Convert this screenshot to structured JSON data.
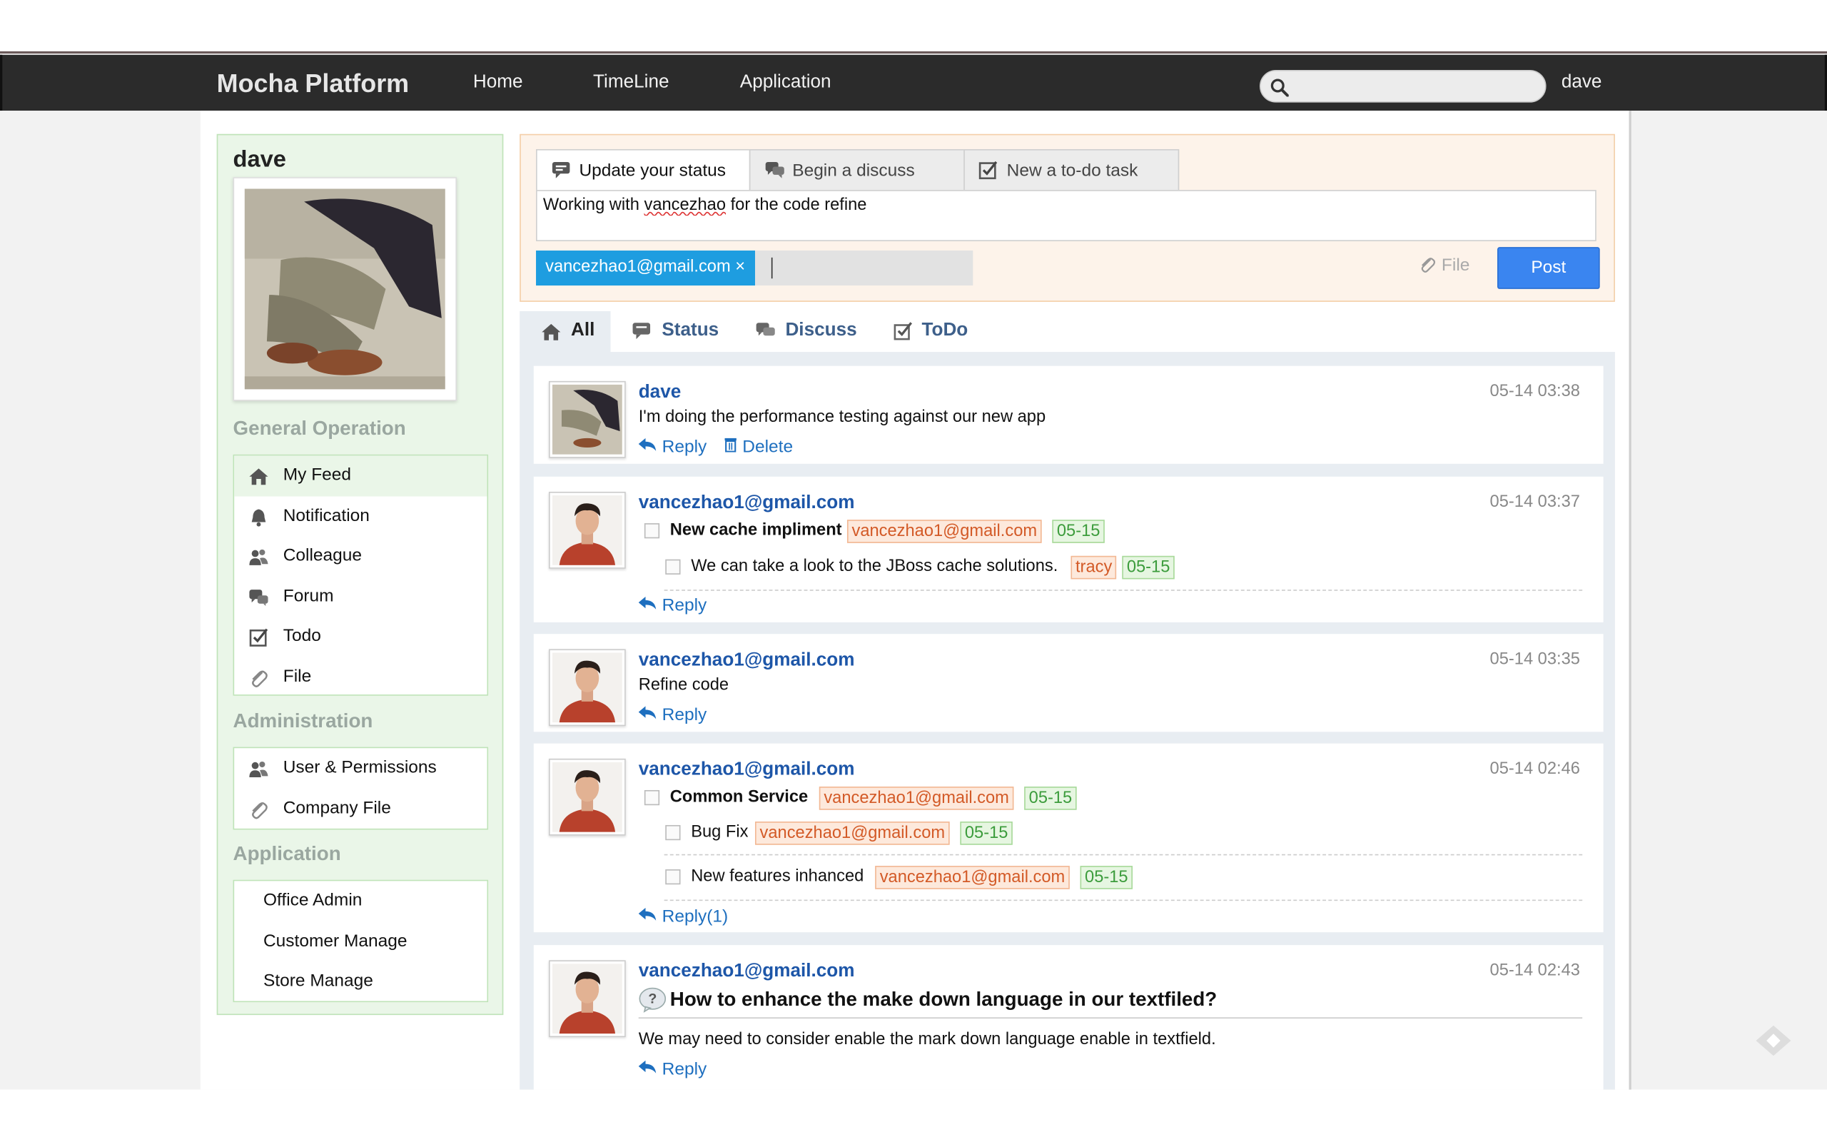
{
  "navbar": {
    "brand": "Mocha Platform",
    "links": [
      "Home",
      "TimeLine",
      "Application"
    ],
    "search_placeholder": "",
    "user": "dave"
  },
  "sidebar": {
    "profile_name": "dave",
    "general_title": "General Operation",
    "general_items": [
      {
        "label": "My Feed",
        "icon": "home-icon"
      },
      {
        "label": "Notification",
        "icon": "bell-icon"
      },
      {
        "label": "Colleague",
        "icon": "users-icon"
      },
      {
        "label": "Forum",
        "icon": "chat-icon"
      },
      {
        "label": "Todo",
        "icon": "checkbox-icon"
      },
      {
        "label": "File",
        "icon": "paperclip-icon"
      }
    ],
    "admin_title": "Administration",
    "admin_items": [
      {
        "label": "User & Permissions",
        "icon": "users-icon"
      },
      {
        "label": "Company File",
        "icon": "paperclip-icon"
      }
    ],
    "app_title": "Application",
    "app_items": [
      "Office Admin",
      "Customer Manage",
      "Store Manage"
    ]
  },
  "composer": {
    "tabs": [
      "Update your status",
      "Begin a discuss",
      "New a to-do task"
    ],
    "status_before": "Working with ",
    "status_mention": "vancezhao",
    "status_after": " for the code refine",
    "chip": "vancezhao1@gmail.com ×",
    "file_label": "File",
    "post_label": "Post"
  },
  "feed_tabs": [
    "All",
    "Status",
    "Discuss",
    "ToDo"
  ],
  "feed": [
    {
      "author": "dave",
      "time": "05-14 03:38",
      "text": "I'm doing the performance testing against our new app",
      "reply": "Reply",
      "delete": "Delete"
    },
    {
      "author": "vancezhao1@gmail.com",
      "time": "05-14 03:37",
      "todo_main": {
        "text": "New cache impliment",
        "user": "vancezhao1@gmail.com",
        "date": "05-15"
      },
      "todo_sub": {
        "text": "We can take a look to the JBoss cache solutions.",
        "user": "tracy",
        "date": "05-15"
      },
      "reply": "Reply"
    },
    {
      "author": "vancezhao1@gmail.com",
      "time": "05-14 03:35",
      "text": "Refine code",
      "reply": "Reply"
    },
    {
      "author": "vancezhao1@gmail.com",
      "time": "05-14 02:46",
      "todo_main": {
        "text": "Common Service",
        "user": "vancezhao1@gmail.com",
        "date": "05-15"
      },
      "todo_sub1": {
        "text": "Bug Fix",
        "user": "vancezhao1@gmail.com",
        "date": "05-15"
      },
      "todo_sub2": {
        "text": "New features inhanced",
        "user": "vancezhao1@gmail.com",
        "date": "05-15"
      },
      "reply": "Reply(1)"
    },
    {
      "author": "vancezhao1@gmail.com",
      "time": "05-14 02:43",
      "question": "How to enhance the make down language in our textfiled?",
      "text": "We may need to consider enable the mark down language enable in textfield.",
      "reply": "Reply"
    }
  ],
  "colors": {
    "navbar_bg": "#2b2b2b",
    "accent_blue": "#3a85f0",
    "link_blue": "#1d56a8",
    "sidebar_green": "#eaf6e8",
    "tag_user": "#d35a27",
    "tag_date": "#3c9c3c"
  }
}
